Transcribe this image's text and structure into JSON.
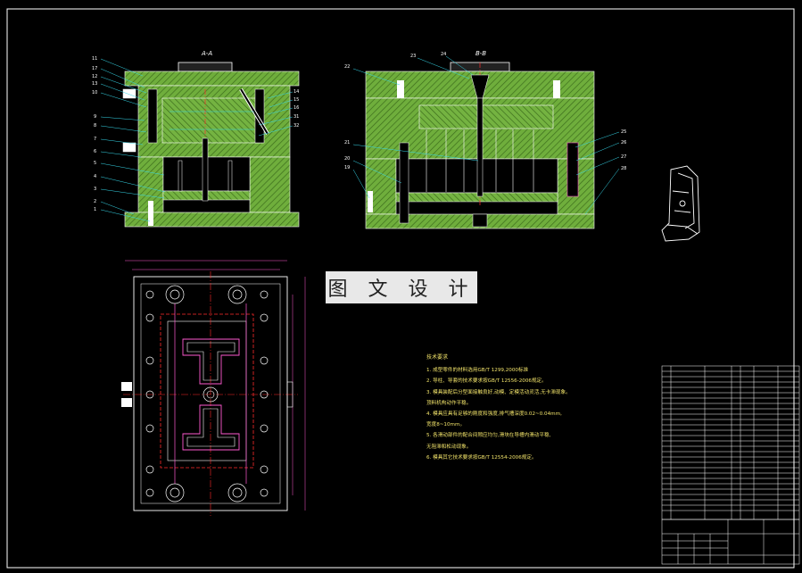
{
  "sections": {
    "aa_label": "A-A",
    "bb_label": "B-B"
  },
  "watermark": "图 文 设 计",
  "left_view_parts": [
    "11",
    "17",
    "12",
    "13",
    "10",
    "9",
    "8",
    "7",
    "6",
    "5",
    "4",
    "3",
    "2",
    "1"
  ],
  "left_view_right_parts": [
    "14",
    "15",
    "16",
    "31",
    "32"
  ],
  "right_view_parts": [
    "22",
    "23",
    "24",
    "21",
    "20",
    "19",
    "25",
    "26",
    "27",
    "28"
  ],
  "tech_notes": {
    "title": "技术要求",
    "items": [
      "1. 成型零件的材料选用GB/T 1299,2000标准",
      "2. 导柱、导套的技术要求按GB/T 12556-2006规定。",
      "3. 模具装配后分型面接触良好,动模、定模活动灵活,无卡滞现象。",
      "   顶料机构动作平稳。",
      "4. 模具应具有足够的刚度和强度,排气槽深度0.02~0.04mm,",
      "   宽度8~10mm。",
      "5. 各滑动部件的配合间隙应均匀,滑块在导槽内滑动平稳,",
      "   无阻滞和松动现象。",
      "6. 模具其它技术要求按GB/T 12554-2006规定。"
    ]
  },
  "colors": {
    "background": "#000000",
    "hatch_green": "#6fae3c",
    "outline": "#ffffff",
    "leader_cyan": "#36d6e8",
    "center_red": "#ff2b2b",
    "dim_magenta": "#ff5ad1",
    "text_yellow": "#f2e36a"
  }
}
